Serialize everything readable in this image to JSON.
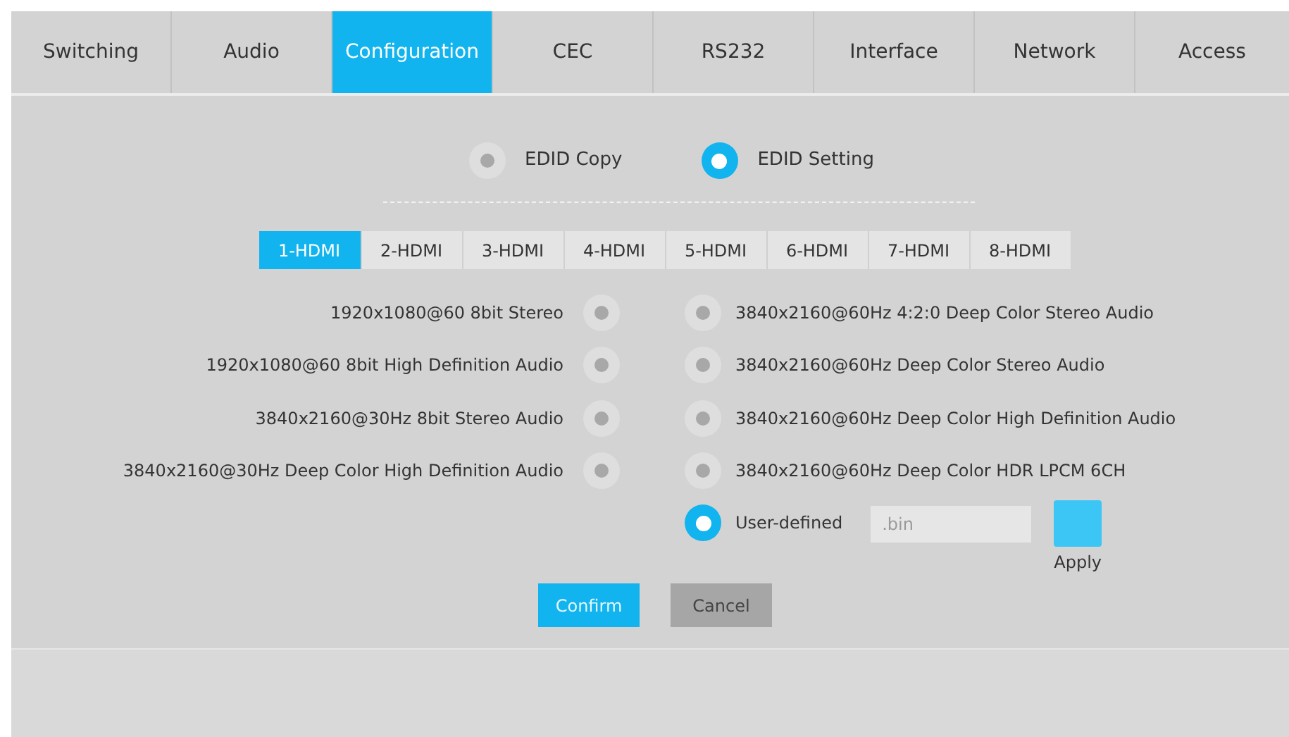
{
  "nav_tabs": [
    {
      "label": "Switching",
      "selected": false
    },
    {
      "label": "Audio",
      "selected": false
    },
    {
      "label": "Configuration",
      "selected": true
    },
    {
      "label": "CEC",
      "selected": false
    },
    {
      "label": "RS232",
      "selected": false
    },
    {
      "label": "Interface",
      "selected": false
    },
    {
      "label": "Network",
      "selected": false
    },
    {
      "label": "Access",
      "selected": false
    }
  ],
  "edid_modes": [
    {
      "label": "EDID Copy",
      "selected": false
    },
    {
      "label": "EDID Setting",
      "selected": true
    }
  ],
  "input_tabs": [
    {
      "label": "1-HDMI",
      "selected": true
    },
    {
      "label": "2-HDMI",
      "selected": false
    },
    {
      "label": "3-HDMI",
      "selected": false
    },
    {
      "label": "4-HDMI",
      "selected": false
    },
    {
      "label": "5-HDMI",
      "selected": false
    },
    {
      "label": "6-HDMI",
      "selected": false
    },
    {
      "label": "7-HDMI",
      "selected": false
    },
    {
      "label": "8-HDMI",
      "selected": false
    }
  ],
  "left_options": [
    {
      "label": "1920x1080@60 8bit Stereo",
      "selected": false
    },
    {
      "label": "1920x1080@60 8bit High Definition Audio",
      "selected": false
    },
    {
      "label": "3840x2160@30Hz 8bit Stereo Audio",
      "selected": false
    },
    {
      "label": "3840x2160@30Hz Deep Color High Definition Audio",
      "selected": false
    }
  ],
  "right_options": [
    {
      "label": "3840x2160@60Hz 4:2:0 Deep Color Stereo Audio",
      "selected": false
    },
    {
      "label": "3840x2160@60Hz Deep Color Stereo Audio",
      "selected": false
    },
    {
      "label": "3840x2160@60Hz Deep Color High Definition Audio",
      "selected": false
    },
    {
      "label": "3840x2160@60Hz Deep Color HDR LPCM 6CH",
      "selected": false
    }
  ],
  "user_defined": {
    "label": "User-defined",
    "selected": true,
    "file_field": {
      "placeholder": ".bin"
    },
    "apply_label": "Apply"
  },
  "buttons": [
    {
      "label": "Confirm",
      "kind": "primary"
    },
    {
      "label": "Cancel",
      "kind": "secondary"
    }
  ]
}
